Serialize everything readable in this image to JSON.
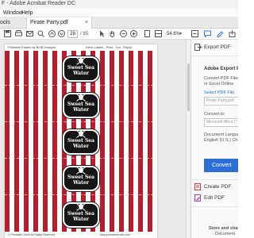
{
  "window": {
    "title": "F - Adobe Acrobat Reader DC"
  },
  "menu": {
    "items": [
      "Window",
      "Help"
    ]
  },
  "tabs": {
    "tools_label": "ools",
    "active_tab": "Pirate Party.pdf",
    "close_glyph": "×"
  },
  "toolbar": {
    "page_current": "28",
    "page_total": "/ 85",
    "zoom": "54.6%"
  },
  "document": {
    "header_left": "Printable Pirates by BOB Designs",
    "header_right": "Drink Labels - Print - Cut - Enjoy!",
    "footer_left": "© Printable Crush All Rights Reserved",
    "footer_right": "www.printablecrush.com",
    "label_line1": "Sweet Sea",
    "label_line2": "Water",
    "label_count": 5,
    "stripe_color": "#b51e2d"
  },
  "right_panel": {
    "export_pdf_label": "Export PDF",
    "section_title": "Adobe Export PDF",
    "desc_line1": "Convert PDF Files to",
    "desc_line2": "or Excel Online",
    "select_file_label": "Select PDF File",
    "file_input_value": "Pirate Party.pdf",
    "convert_to_label": "Convert to",
    "format_value": "Microsoft Word (*.",
    "doc_lang_label": "Document Languag",
    "lang_value": "English (U.S.) Change",
    "convert_button": "Convert",
    "create_pdf_label": "Create PDF",
    "edit_pdf_label": "Edit PDF",
    "promo_line1": "Store and share",
    "promo_line2": "Document"
  },
  "colors": {
    "accent": "#2d6fd6",
    "create_icon": "#d9363e",
    "edit_icon": "#c03ab0"
  }
}
